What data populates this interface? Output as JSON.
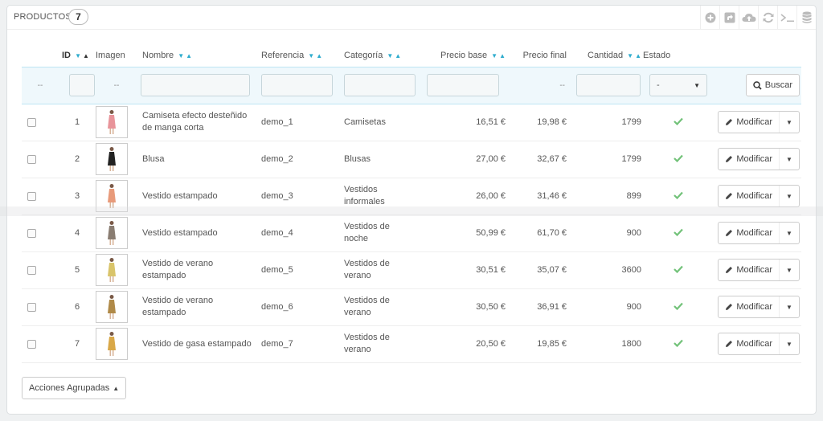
{
  "panel": {
    "title": "PRODUCTOS",
    "count": "7"
  },
  "toolbar": {
    "icons": [
      "add-icon",
      "export-icon",
      "cloud-upload-icon",
      "refresh-icon",
      "sql-terminal-icon",
      "database-icon"
    ]
  },
  "columns": {
    "id": "ID",
    "image": "Imagen",
    "name": "Nombre",
    "reference": "Referencia",
    "category": "Categoría",
    "base_price": "Precio base",
    "final_price": "Precio final",
    "quantity": "Cantidad",
    "status": "Estado"
  },
  "filters": {
    "dash": "--",
    "status_selected": "-",
    "search_label": "Buscar"
  },
  "rows": [
    {
      "id": "1",
      "name": "Camiseta efecto desteñido de manga corta",
      "reference": "demo_1",
      "category": "Camisetas",
      "base_price": "16,51 €",
      "final_price": "19,98 €",
      "quantity": "1799",
      "status": "active"
    },
    {
      "id": "2",
      "name": "Blusa",
      "reference": "demo_2",
      "category": "Blusas",
      "base_price": "27,00 €",
      "final_price": "32,67 €",
      "quantity": "1799",
      "status": "active"
    },
    {
      "id": "3",
      "name": "Vestido estampado",
      "reference": "demo_3",
      "category": "Vestidos informales",
      "base_price": "26,00 €",
      "final_price": "31,46 €",
      "quantity": "899",
      "status": "active"
    },
    {
      "id": "4",
      "name": "Vestido estampado",
      "reference": "demo_4",
      "category": "Vestidos de noche",
      "base_price": "50,99 €",
      "final_price": "61,70 €",
      "quantity": "900",
      "status": "active"
    },
    {
      "id": "5",
      "name": "Vestido de verano estampado",
      "reference": "demo_5",
      "category": "Vestidos de verano",
      "base_price": "30,51 €",
      "final_price": "35,07 €",
      "quantity": "3600",
      "status": "active"
    },
    {
      "id": "6",
      "name": "Vestido de verano estampado",
      "reference": "demo_6",
      "category": "Vestidos de verano",
      "base_price": "30,50 €",
      "final_price": "36,91 €",
      "quantity": "900",
      "status": "active"
    },
    {
      "id": "7",
      "name": "Vestido de gasa estampado",
      "reference": "demo_7",
      "category": "Vestidos de verano",
      "base_price": "20,50 €",
      "final_price": "19,85 €",
      "quantity": "1800",
      "status": "active"
    }
  ],
  "actions": {
    "edit_label": "Modificar"
  },
  "bulk": {
    "label": "Acciones Agrupadas"
  },
  "colors": {
    "accent": "#2eacce",
    "check": "#72c279",
    "filter_bg": "#eff8fc"
  }
}
